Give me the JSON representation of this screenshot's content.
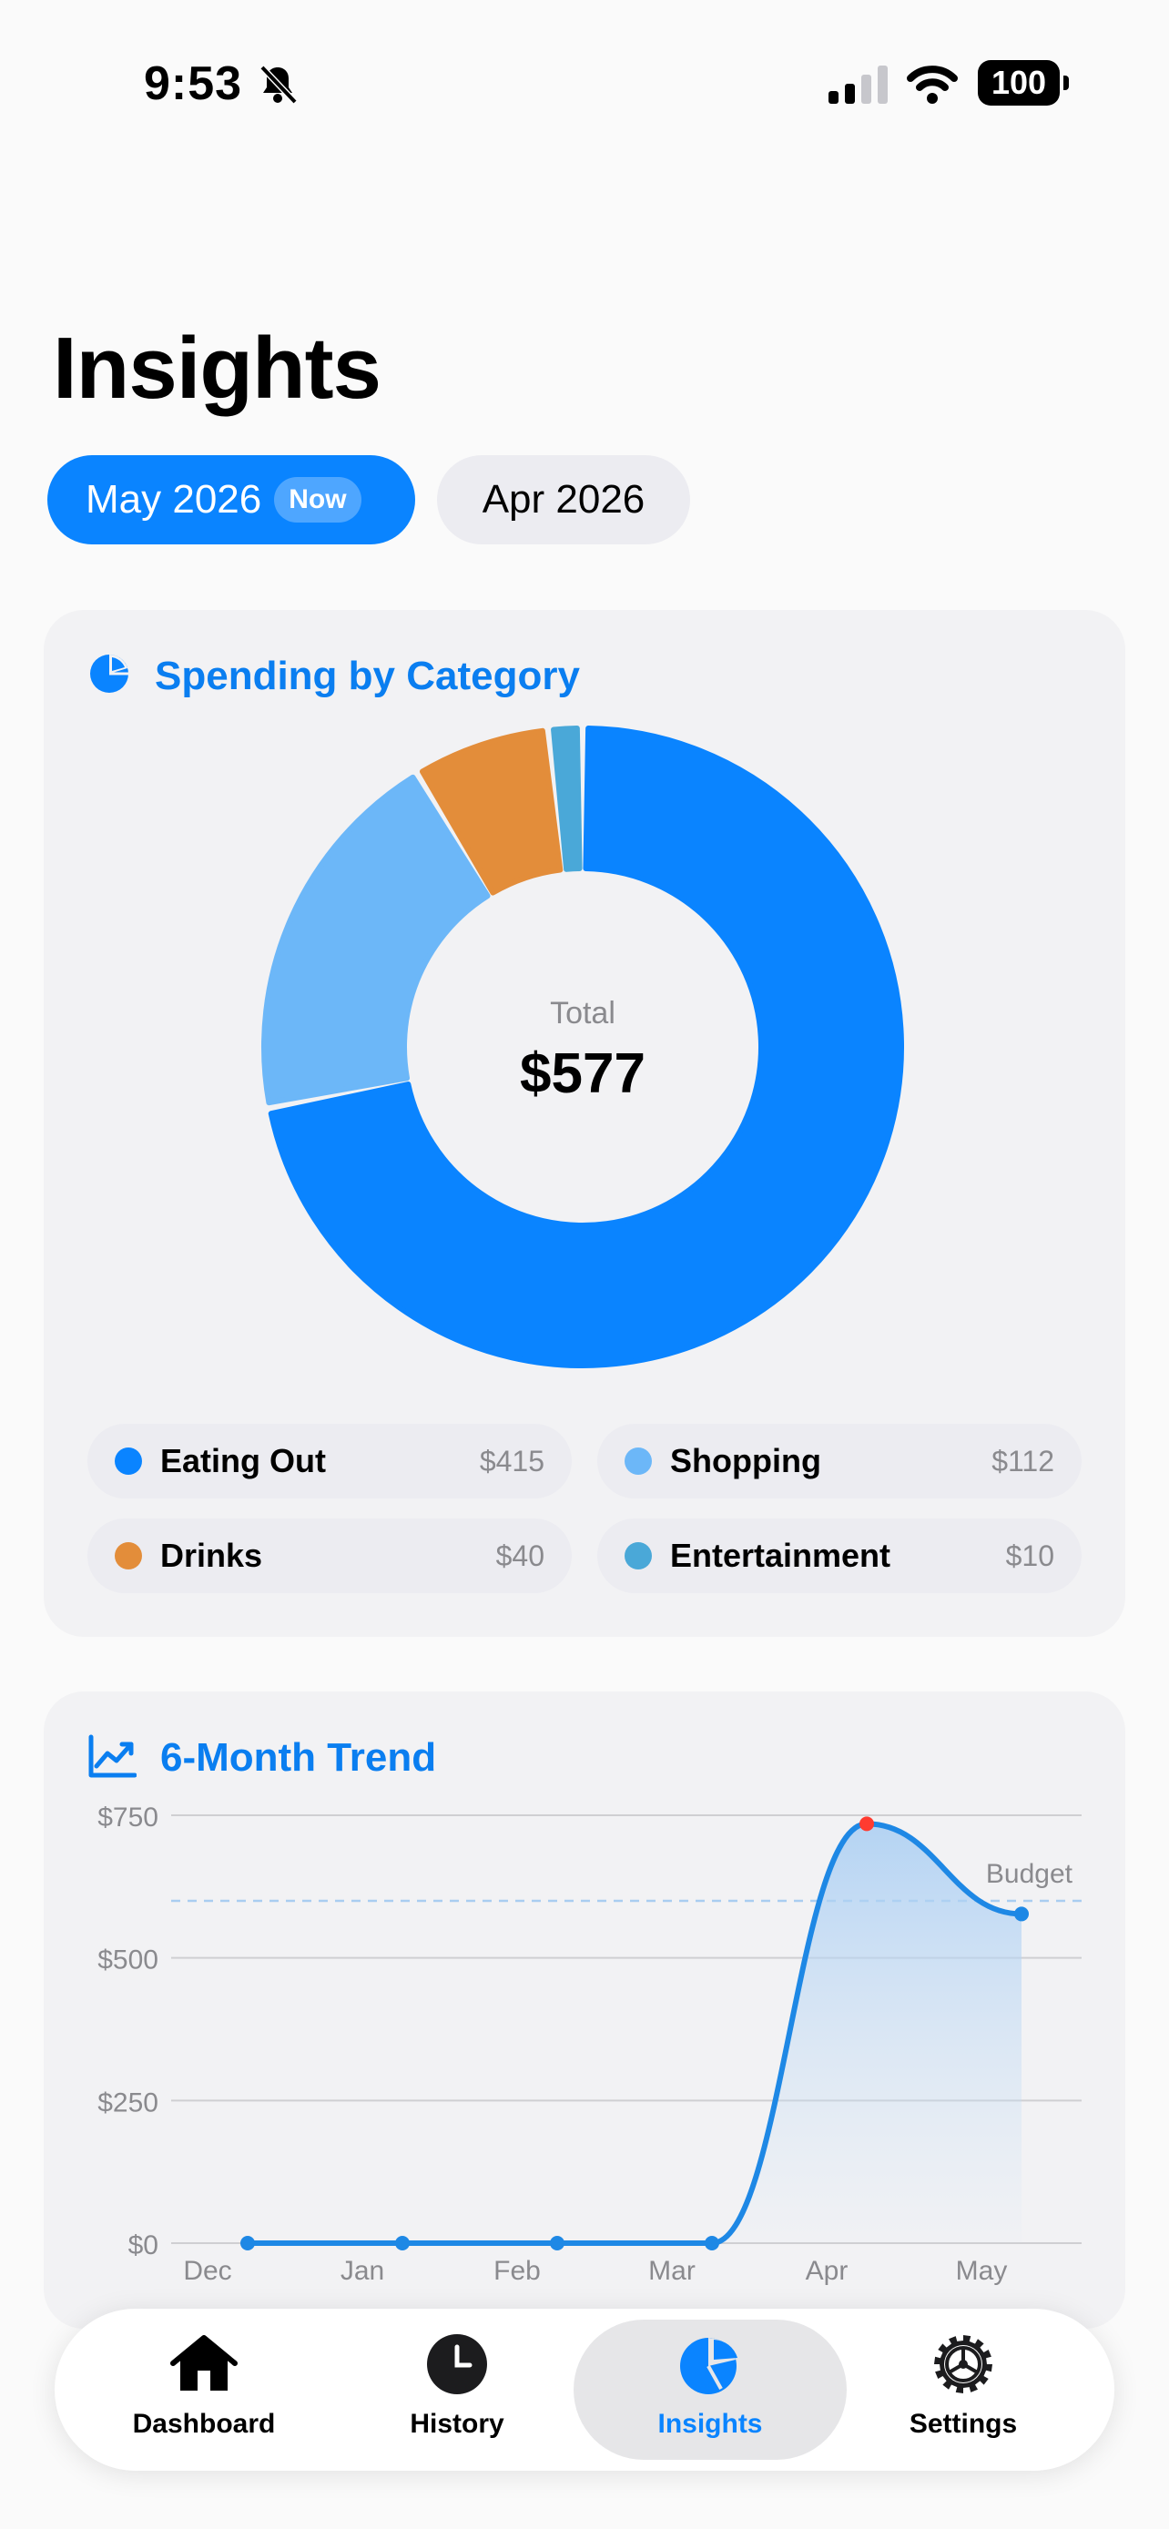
{
  "status_bar": {
    "time": "9:53",
    "battery": "100"
  },
  "page": {
    "title": "Insights"
  },
  "months": [
    {
      "label": "May 2026",
      "badge": "Now",
      "selected": true
    },
    {
      "label": "Apr 2026",
      "selected": false
    }
  ],
  "spending_card": {
    "title": "Spending by Category",
    "total_label": "Total",
    "total_value": "$577",
    "legend": [
      {
        "name": "Eating Out",
        "amount": "$415",
        "color": "#0a84ff"
      },
      {
        "name": "Shopping",
        "amount": "$112",
        "color": "#6cb7f8"
      },
      {
        "name": "Drinks",
        "amount": "$40",
        "color": "#e38d3a"
      },
      {
        "name": "Entertainment",
        "amount": "$10",
        "color": "#4aa8d8"
      }
    ]
  },
  "trend_card": {
    "title": "6-Month Trend",
    "budget_label": "Budget"
  },
  "chart_data": [
    {
      "type": "pie",
      "title": "Spending by Category",
      "categories": [
        "Eating Out",
        "Shopping",
        "Drinks",
        "Entertainment"
      ],
      "values": [
        415,
        112,
        40,
        10
      ],
      "colors": [
        "#0a84ff",
        "#6cb7f8",
        "#e38d3a",
        "#4aa8d8"
      ],
      "center_label": "Total",
      "center_value": "$577"
    },
    {
      "type": "area",
      "title": "6-Month Trend",
      "categories": [
        "Dec",
        "Jan",
        "Feb",
        "Mar",
        "Apr",
        "May"
      ],
      "values": [
        0,
        0,
        0,
        0,
        735,
        577
      ],
      "budget": 600,
      "budget_label": "Budget",
      "ylim": [
        0,
        750
      ],
      "yticks": [
        0,
        250,
        500,
        750
      ],
      "ytick_labels": [
        "$0",
        "$250",
        "$500",
        "$750"
      ],
      "highlight_index": 4,
      "colors": {
        "line": "#1e88e5",
        "highlight": "#ff3b30",
        "budget": "#a9cdf0"
      },
      "grid": true
    }
  ],
  "tab_bar": {
    "tabs": [
      {
        "label": "Dashboard",
        "icon": "house-icon",
        "active": false
      },
      {
        "label": "History",
        "icon": "clock-icon",
        "active": false
      },
      {
        "label": "Insights",
        "icon": "chart-pie-icon",
        "active": true
      },
      {
        "label": "Settings",
        "icon": "gear-icon",
        "active": false
      }
    ]
  }
}
